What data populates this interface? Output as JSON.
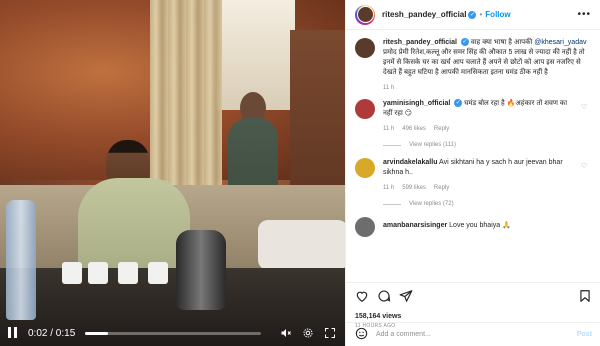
{
  "header": {
    "username": "ritesh_pandey_official",
    "follow_label": "Follow",
    "more_icon": "more-icon"
  },
  "video": {
    "current_time": "0:02",
    "duration": "0:15",
    "time_display": "0:02 / 0:15",
    "progress_fraction": 0.13
  },
  "caption": {
    "username": "ritesh_pandey_official",
    "text_prefix": "वाह क्या भाषा है आपकी ",
    "mention": "@khesari_yadav",
    "text_rest": "प्रमोद प्रेमी रितेश,कल्लू और समर सिंह की औकात 5 लाख से ज्यादा की नहीं है तो इनमें से किसके घर का खर्च आप चलाते हैं अपने से छोटों को आप इस नजरिए से देखते हैं बहुत घटिया है आपकी मानसिकता इतना घमंड ठीक नहीं है",
    "age": "11 h"
  },
  "comments": [
    {
      "username": "yaminisingh_official",
      "text": "घमंड बोल रहा है 🔥अहंकार तो शवण का नहीं रहा 😏",
      "time": "11 h",
      "likes": "496 likes",
      "reply_label": "Reply",
      "view_replies": "View replies (111)",
      "avatar_color": "#b03a3a"
    },
    {
      "username": "arvindakelakallu",
      "text": "Avi sikhtani ha y sach h aur jeevan bhar sikhna h..",
      "time": "11 h",
      "likes": "599 likes",
      "reply_label": "Reply",
      "view_replies": "View replies (72)",
      "avatar_color": "#d8a829"
    },
    {
      "username": "amanbanarsisinger",
      "text": "Love you bhaiya 🙏",
      "avatar_color": "#6d6d6d"
    }
  ],
  "actions": {
    "views": "158,164 views",
    "ago": "11 HOURS AGO"
  },
  "add_comment": {
    "placeholder": "Add a comment...",
    "post_label": "Post"
  }
}
